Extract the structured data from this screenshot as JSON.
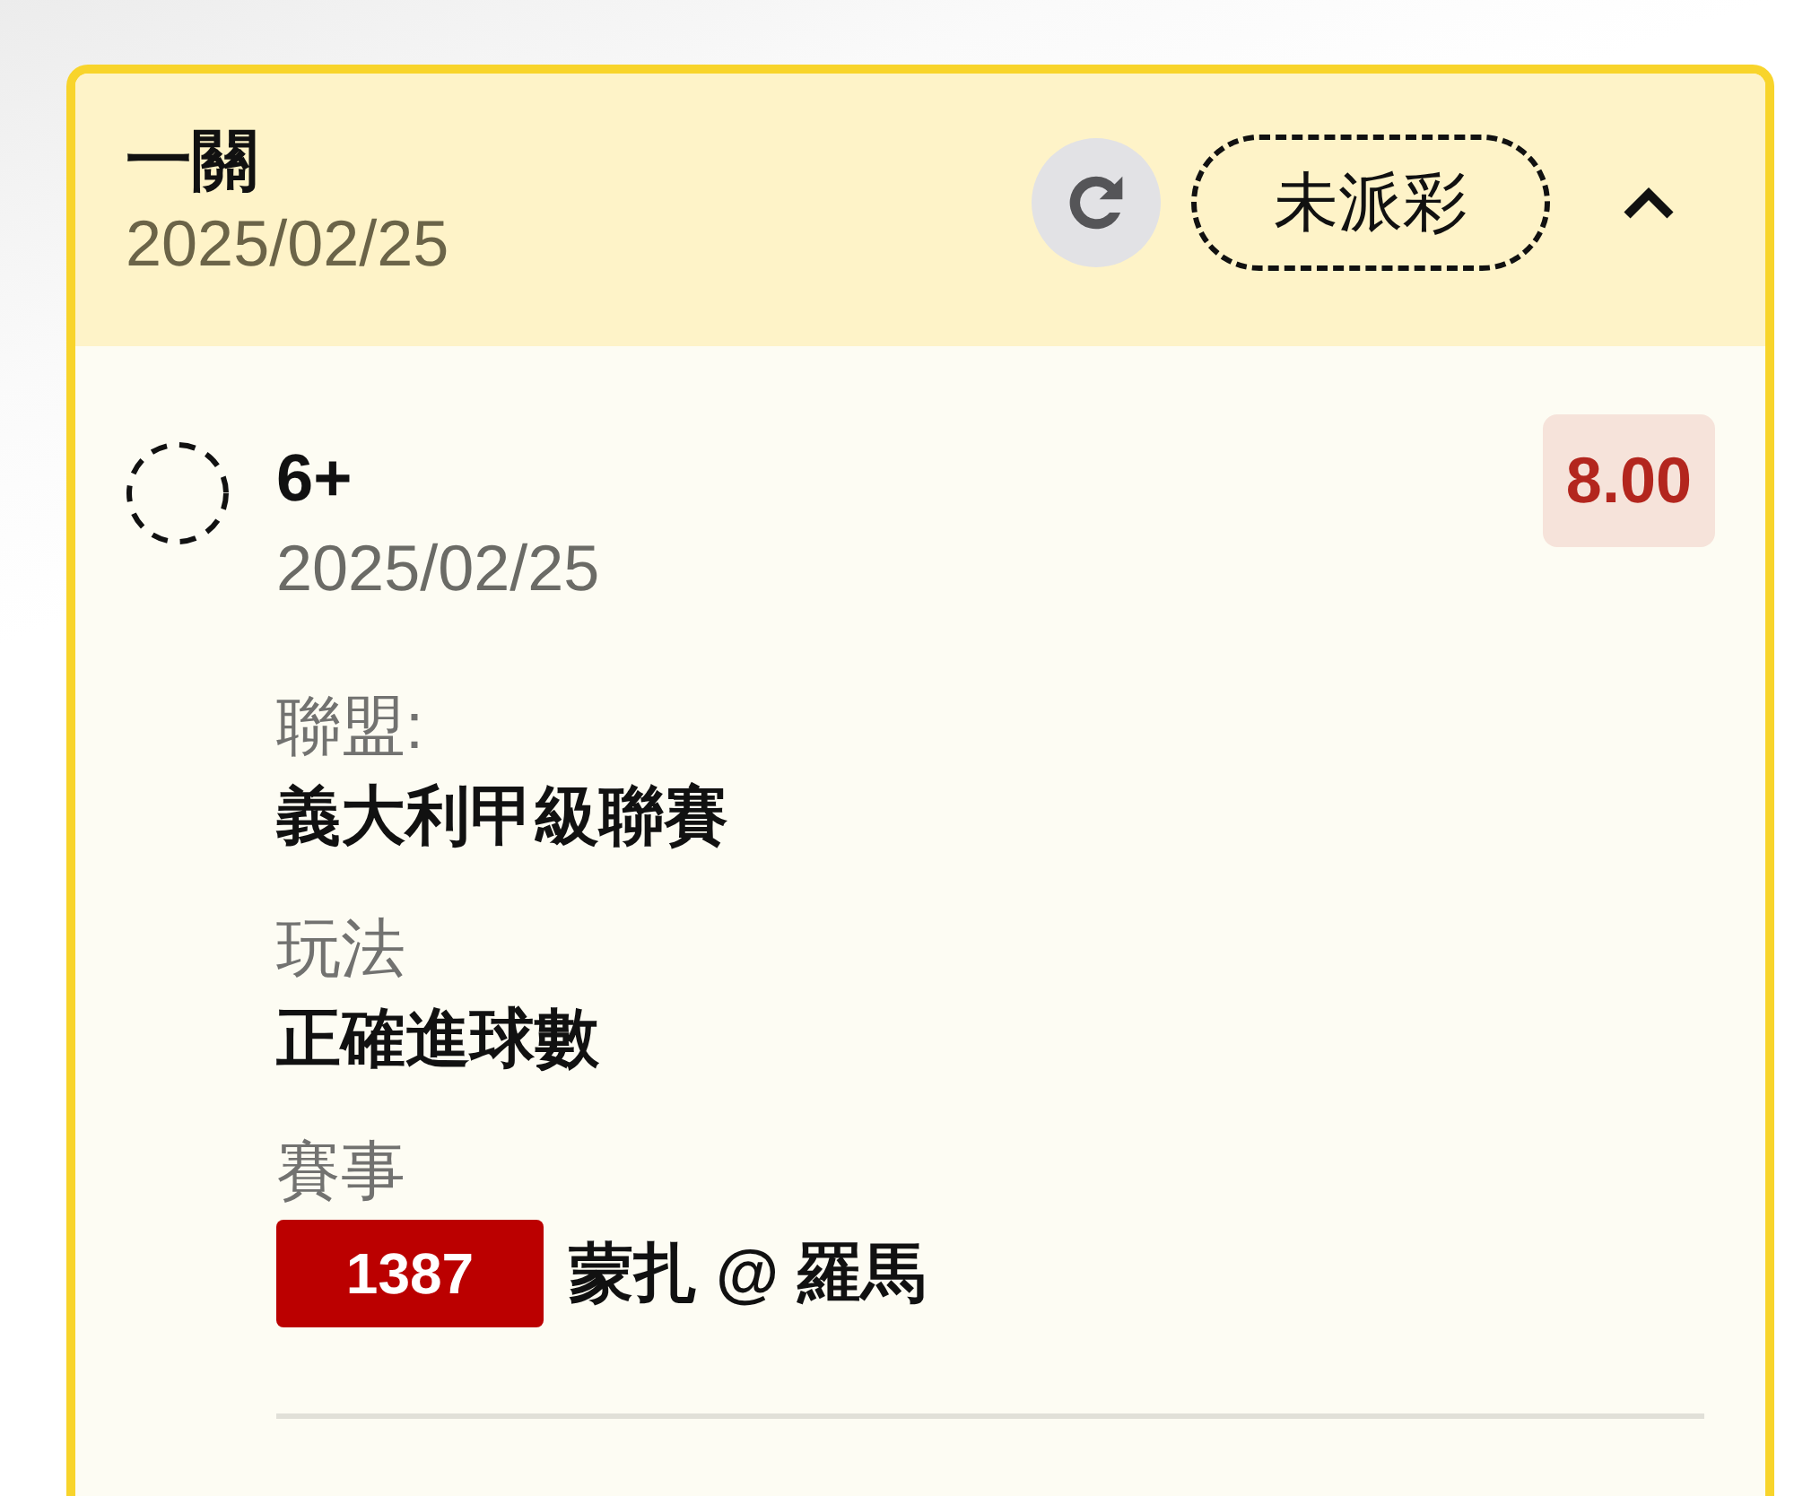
{
  "card": {
    "title": "一關",
    "date": "2025/02/25",
    "status": "未派彩",
    "expanded": true,
    "legs": [
      {
        "selection": "6+",
        "date": "2025/02/25",
        "odds": "8.00",
        "fields": [
          {
            "kind": "text",
            "label": "聯盟:",
            "value": "義大利甲級聯賽"
          },
          {
            "kind": "text",
            "label": "玩法",
            "value": "正確進球數"
          },
          {
            "kind": "match",
            "label": "賽事",
            "match_number": "1387",
            "value": "蒙扎 @ 羅馬"
          }
        ]
      }
    ]
  }
}
